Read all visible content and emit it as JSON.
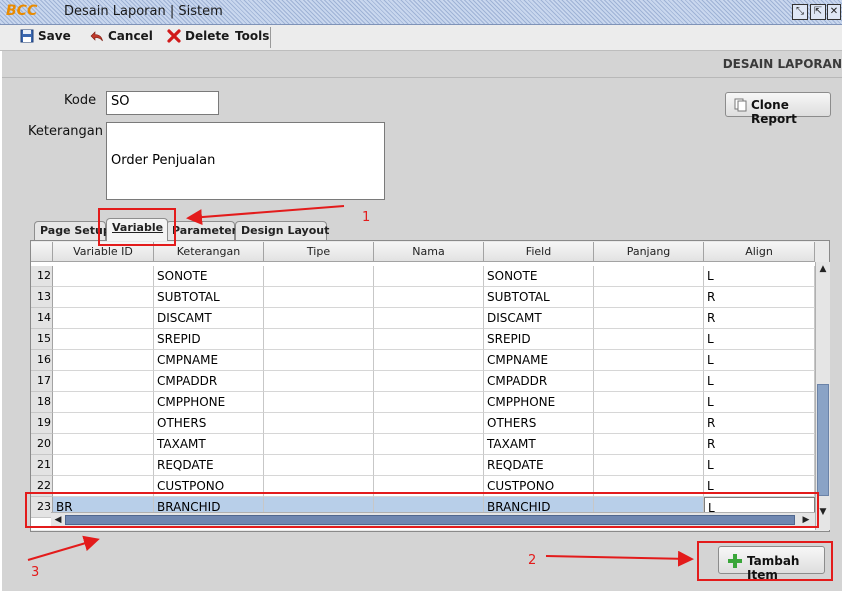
{
  "window": {
    "logo": "BCC",
    "title": "Desain Laporan | Sistem",
    "buttons": [
      "restore-icon",
      "maximize-icon",
      "close-icon"
    ]
  },
  "toolbar": {
    "save_label": "Save",
    "cancel_label": "Cancel",
    "delete_label": "Delete",
    "tools_label": "Tools"
  },
  "page": {
    "header_title": "DESAIN LAPORAN",
    "kode_label": "Kode",
    "kode_value": "SO",
    "keterangan_label": "Keterangan",
    "keterangan_value": "Order Penjualan",
    "clone_button": "Clone Report",
    "add_item_button": "Tambah Item"
  },
  "tabs": [
    {
      "label": "Page Setup",
      "active": false
    },
    {
      "label": "Variable",
      "active": true
    },
    {
      "label": "Parameter",
      "active": false
    },
    {
      "label": "Design Layout",
      "active": false
    }
  ],
  "grid": {
    "columns": [
      "Variable ID",
      "Keterangan",
      "Tipe",
      "Nama",
      "Field",
      "Panjang",
      "Align"
    ],
    "rows": [
      {
        "num": "12",
        "variable_id": "",
        "keterangan": "SONOTE",
        "tipe": "",
        "nama": "",
        "field": "SONOTE",
        "panjang": "",
        "align": "L"
      },
      {
        "num": "13",
        "variable_id": "",
        "keterangan": "SUBTOTAL",
        "tipe": "",
        "nama": "",
        "field": "SUBTOTAL",
        "panjang": "",
        "align": "R"
      },
      {
        "num": "14",
        "variable_id": "",
        "keterangan": "DISCAMT",
        "tipe": "",
        "nama": "",
        "field": "DISCAMT",
        "panjang": "",
        "align": "R"
      },
      {
        "num": "15",
        "variable_id": "",
        "keterangan": "SREPID",
        "tipe": "",
        "nama": "",
        "field": "SREPID",
        "panjang": "",
        "align": "L"
      },
      {
        "num": "16",
        "variable_id": "",
        "keterangan": "CMPNAME",
        "tipe": "",
        "nama": "",
        "field": "CMPNAME",
        "panjang": "",
        "align": "L"
      },
      {
        "num": "17",
        "variable_id": "",
        "keterangan": "CMPADDR",
        "tipe": "",
        "nama": "",
        "field": "CMPADDR",
        "panjang": "",
        "align": "L"
      },
      {
        "num": "18",
        "variable_id": "",
        "keterangan": "CMPPHONE",
        "tipe": "",
        "nama": "",
        "field": "CMPPHONE",
        "panjang": "",
        "align": "L"
      },
      {
        "num": "19",
        "variable_id": "",
        "keterangan": "OTHERS",
        "tipe": "",
        "nama": "",
        "field": "OTHERS",
        "panjang": "",
        "align": "R"
      },
      {
        "num": "20",
        "variable_id": "",
        "keterangan": "TAXAMT",
        "tipe": "",
        "nama": "",
        "field": "TAXAMT",
        "panjang": "",
        "align": "R"
      },
      {
        "num": "21",
        "variable_id": "",
        "keterangan": "REQDATE",
        "tipe": "",
        "nama": "",
        "field": "REQDATE",
        "panjang": "",
        "align": "L"
      },
      {
        "num": "22",
        "variable_id": "",
        "keterangan": "CUSTPONO",
        "tipe": "",
        "nama": "",
        "field": "CUSTPONO",
        "panjang": "",
        "align": "L"
      },
      {
        "num": "23",
        "variable_id": "BR",
        "keterangan": "BRANCHID",
        "tipe": "",
        "nama": "",
        "field": "BRANCHID",
        "panjang": "",
        "align": "L",
        "selected": true
      }
    ]
  },
  "annotations": [
    "1",
    "2",
    "3"
  ],
  "colors": {
    "annotation": "#e31b1b",
    "selection": "#b8cfe9",
    "panel": "#d4d4d4",
    "add_icon": "#3aa63a"
  }
}
